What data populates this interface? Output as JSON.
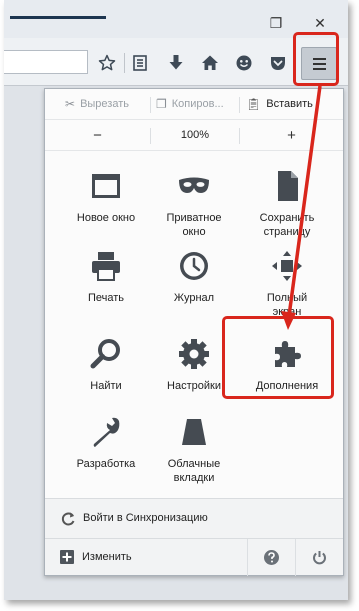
{
  "window": {
    "restore_glyph": "❐",
    "close_glyph": "✕"
  },
  "toolbar": {
    "icons": [
      "star-icon",
      "reading-list-icon",
      "download-icon",
      "home-icon",
      "hello-icon",
      "pocket-icon",
      "menu-icon"
    ]
  },
  "menu": {
    "edit": {
      "cut": "Вырезать",
      "copy": "Копиров...",
      "paste": "Вставить"
    },
    "zoom": {
      "minus": "−",
      "value": "100%",
      "plus": "+"
    },
    "items": {
      "new_window": "Новое окно",
      "private_window_1": "Приватное",
      "private_window_2": "окно",
      "save_page_1": "Сохранить",
      "save_page_2": "страницу",
      "print": "Печать",
      "history": "Журнал",
      "fullscreen_1": "Полный",
      "fullscreen_2": "экран",
      "find": "Найти",
      "settings": "Настройки",
      "addons": "Дополнения",
      "developer": "Разработка",
      "cloud_tabs_1": "Облачные",
      "cloud_tabs_2": "вкладки"
    },
    "sync": "Войти в Синхронизацию",
    "customize": "Изменить"
  },
  "colors": {
    "highlight": "#d9261c",
    "icon": "#454b52"
  }
}
